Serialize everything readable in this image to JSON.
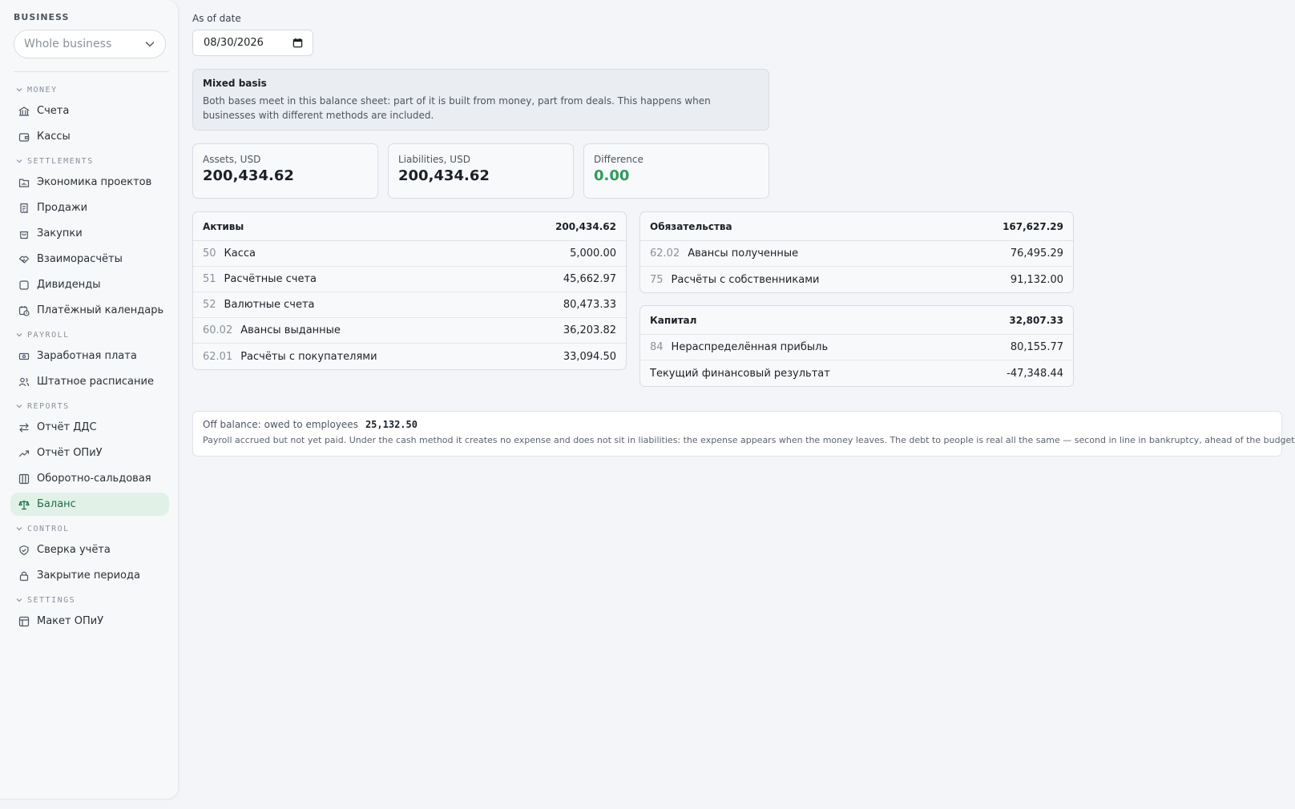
{
  "sidebar": {
    "business_label": "BUSINESS",
    "business_select": "Whole business",
    "sections": [
      {
        "title": "MONEY",
        "items": [
          {
            "label": "Счета",
            "icon": "bank-icon"
          },
          {
            "label": "Кассы",
            "icon": "wallet-icon"
          }
        ]
      },
      {
        "title": "SETTLEMENTS",
        "items": [
          {
            "label": "Экономика проектов",
            "icon": "folder-chart-icon"
          },
          {
            "label": "Продажи",
            "icon": "receipt-icon"
          },
          {
            "label": "Закупки",
            "icon": "shopping-bag-icon"
          },
          {
            "label": "Взаиморасчёты",
            "icon": "handshake-icon"
          },
          {
            "label": "Дивиденды",
            "icon": "square-icon"
          },
          {
            "label": "Платёжный календарь",
            "icon": "calendar-clock-icon"
          }
        ]
      },
      {
        "title": "PAYROLL",
        "items": [
          {
            "label": "Заработная плата",
            "icon": "banknote-icon"
          },
          {
            "label": "Штатное расписание",
            "icon": "users-icon"
          }
        ]
      },
      {
        "title": "REPORTS",
        "items": [
          {
            "label": "Отчёт ДДС",
            "icon": "arrows-left-right-icon"
          },
          {
            "label": "Отчёт ОПиУ",
            "icon": "trend-up-icon"
          },
          {
            "label": "Оборотно-сальдовая",
            "icon": "columns-icon"
          },
          {
            "label": "Баланс",
            "icon": "scale-icon",
            "active": true
          }
        ]
      },
      {
        "title": "CONTROL",
        "items": [
          {
            "label": "Сверка учёта",
            "icon": "shield-check-icon"
          },
          {
            "label": "Закрытие периода",
            "icon": "lock-icon"
          }
        ]
      },
      {
        "title": "SETTINGS",
        "items": [
          {
            "label": "Макет ОПиУ",
            "icon": "table-icon"
          }
        ]
      }
    ]
  },
  "main": {
    "date_label": "As of date",
    "date_value": "08/30/2026",
    "notice": {
      "title": "Mixed basis",
      "body": "Both bases meet in this balance sheet: part of it is built from money, part from deals. This happens when businesses with different methods are included."
    },
    "stats": [
      {
        "label": "Assets, USD",
        "value": "200,434.62"
      },
      {
        "label": "Liabilities, USD",
        "value": "200,434.62"
      },
      {
        "label": "Difference",
        "value": "0.00"
      }
    ],
    "assets": {
      "title": "Активы",
      "total": "200,434.62",
      "rows": [
        {
          "code": "50",
          "name": "Касса",
          "value": "5,000.00"
        },
        {
          "code": "51",
          "name": "Расчётные счета",
          "value": "45,662.97"
        },
        {
          "code": "52",
          "name": "Валютные счета",
          "value": "80,473.33"
        },
        {
          "code": "60.02",
          "name": "Авансы выданные",
          "value": "36,203.82"
        },
        {
          "code": "62.01",
          "name": "Расчёты с покупателями",
          "value": "33,094.50"
        }
      ]
    },
    "liabilities": {
      "title": "Обязательства",
      "total": "167,627.29",
      "rows": [
        {
          "code": "62.02",
          "name": "Авансы полученные",
          "value": "76,495.29"
        },
        {
          "code": "75",
          "name": "Расчёты с собственниками",
          "value": "91,132.00"
        }
      ]
    },
    "equity": {
      "title": "Капитал",
      "total": "32,807.33",
      "rows": [
        {
          "code": "84",
          "name": "Нераспределённая прибыль",
          "value": "80,155.77"
        },
        {
          "code": "",
          "name": "Текущий финансовый результат",
          "value": "-47,348.44"
        }
      ]
    },
    "off_balance": {
      "label": "Off balance: owed to employees",
      "amount": "25,132.50",
      "note": "Payroll accrued but not yet paid. Under the cash method it creates no expense and does not sit in liabilities: the expense appears when the money leaves. The debt to people is real all the same — second in line in bankruptcy, ahead of the budget."
    }
  },
  "colors": {
    "accent": "#2e9a5c",
    "active_bg": "#e2f1e8",
    "active_text": "#1f6e46"
  }
}
